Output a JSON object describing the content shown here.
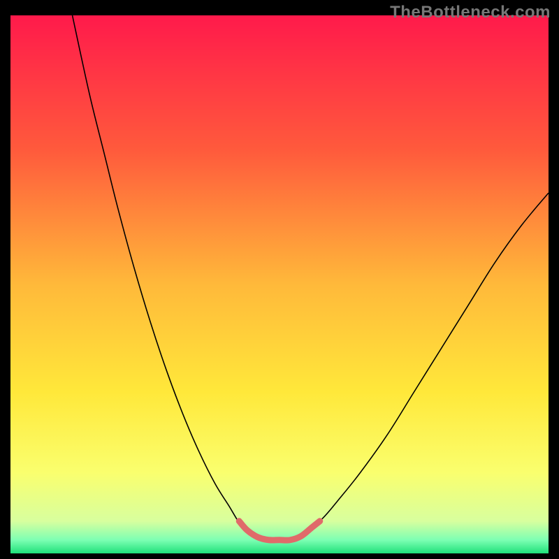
{
  "watermark": "TheBottleneck.com",
  "chart_data": {
    "type": "line",
    "title": "",
    "xlabel": "",
    "ylabel": "",
    "xlim": [
      0,
      100
    ],
    "ylim": [
      0,
      100
    ],
    "grid": false,
    "legend": false,
    "gradient_stops": [
      {
        "offset": 0,
        "color": "#ff1a4b"
      },
      {
        "offset": 0.25,
        "color": "#ff5a3c"
      },
      {
        "offset": 0.5,
        "color": "#ffb93a"
      },
      {
        "offset": 0.7,
        "color": "#ffe83a"
      },
      {
        "offset": 0.85,
        "color": "#faff6e"
      },
      {
        "offset": 0.94,
        "color": "#d8ff9e"
      },
      {
        "offset": 0.975,
        "color": "#7dffb3"
      },
      {
        "offset": 1.0,
        "color": "#1fe07a"
      }
    ],
    "series": [
      {
        "name": "curve-left",
        "stroke": "#000000",
        "width": 1.6,
        "points": [
          {
            "x": 11.5,
            "y": 100.0
          },
          {
            "x": 13.0,
            "y": 93.0
          },
          {
            "x": 15.0,
            "y": 84.0
          },
          {
            "x": 17.5,
            "y": 74.0
          },
          {
            "x": 20.0,
            "y": 64.0
          },
          {
            "x": 23.0,
            "y": 53.0
          },
          {
            "x": 26.0,
            "y": 43.0
          },
          {
            "x": 29.0,
            "y": 34.0
          },
          {
            "x": 32.0,
            "y": 26.0
          },
          {
            "x": 35.0,
            "y": 19.0
          },
          {
            "x": 38.0,
            "y": 13.0
          },
          {
            "x": 40.5,
            "y": 9.0
          },
          {
            "x": 43.0,
            "y": 5.0
          },
          {
            "x": 45.0,
            "y": 3.5
          },
          {
            "x": 47.0,
            "y": 2.7
          },
          {
            "x": 49.0,
            "y": 2.5
          }
        ]
      },
      {
        "name": "curve-right",
        "stroke": "#000000",
        "width": 1.6,
        "points": [
          {
            "x": 51.0,
            "y": 2.5
          },
          {
            "x": 53.0,
            "y": 3.0
          },
          {
            "x": 55.0,
            "y": 4.0
          },
          {
            "x": 58.0,
            "y": 6.5
          },
          {
            "x": 61.0,
            "y": 10.0
          },
          {
            "x": 65.0,
            "y": 15.0
          },
          {
            "x": 70.0,
            "y": 22.0
          },
          {
            "x": 75.0,
            "y": 30.0
          },
          {
            "x": 80.0,
            "y": 38.0
          },
          {
            "x": 85.0,
            "y": 46.0
          },
          {
            "x": 90.0,
            "y": 54.0
          },
          {
            "x": 95.0,
            "y": 61.0
          },
          {
            "x": 100.0,
            "y": 67.0
          }
        ]
      },
      {
        "name": "highlight-minimum",
        "stroke": "#e06a6a",
        "width": 9,
        "linecap": "round",
        "points": [
          {
            "x": 42.5,
            "y": 6.0
          },
          {
            "x": 44.0,
            "y": 4.3
          },
          {
            "x": 46.0,
            "y": 3.0
          },
          {
            "x": 48.0,
            "y": 2.5
          },
          {
            "x": 50.0,
            "y": 2.5
          },
          {
            "x": 52.0,
            "y": 2.5
          },
          {
            "x": 54.0,
            "y": 3.2
          },
          {
            "x": 56.0,
            "y": 4.8
          },
          {
            "x": 57.5,
            "y": 6.0
          }
        ]
      }
    ]
  }
}
